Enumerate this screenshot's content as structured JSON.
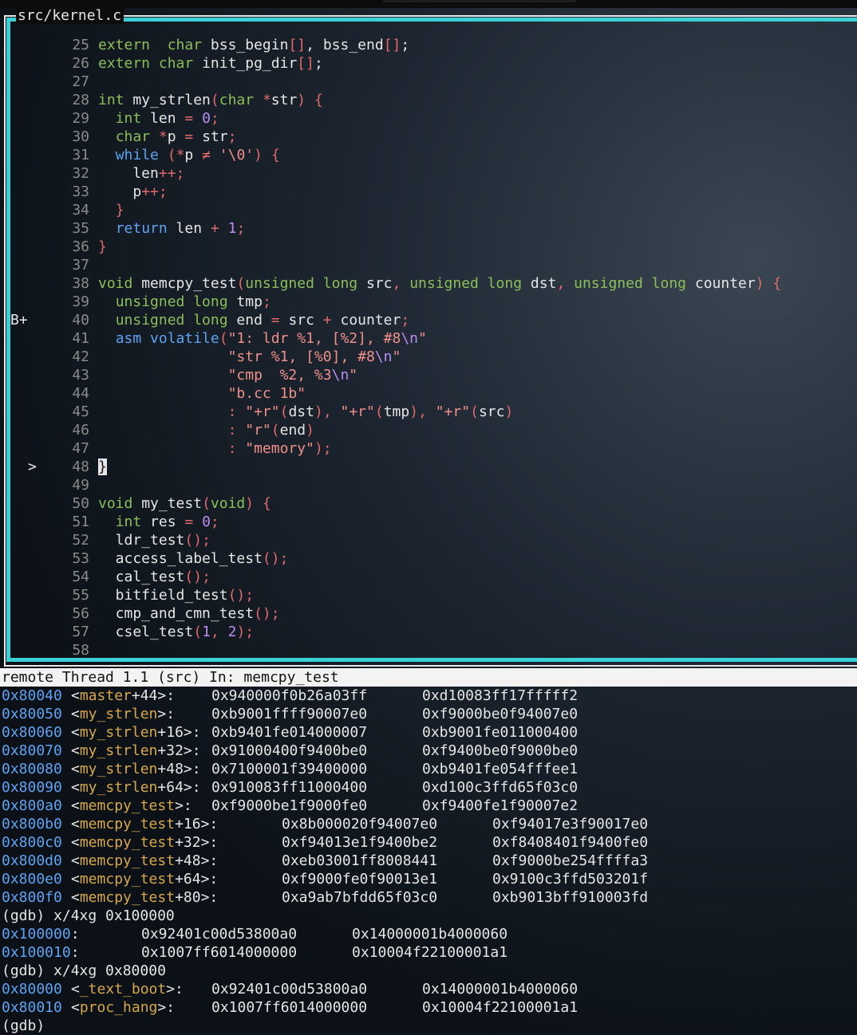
{
  "source_pane": {
    "title": "src/kernel.c",
    "lines": [
      {
        "n": "25",
        "m": "",
        "t": [
          [
            "ty",
            "extern"
          ],
          [
            "",
            "  "
          ],
          [
            "ty",
            "char"
          ],
          [
            "",
            " bss_begin"
          ],
          [
            "pu",
            "[]"
          ],
          [
            "",
            ", bss_end"
          ],
          [
            "pu",
            "[]"
          ],
          [
            "",
            ";"
          ]
        ]
      },
      {
        "n": "26",
        "m": "",
        "t": [
          [
            "ty",
            "extern"
          ],
          [
            "",
            " "
          ],
          [
            "ty",
            "char"
          ],
          [
            "",
            " init_pg_dir"
          ],
          [
            "pu",
            "[]"
          ],
          [
            "",
            ";"
          ]
        ]
      },
      {
        "n": "27",
        "m": "",
        "t": []
      },
      {
        "n": "28",
        "m": "",
        "t": [
          [
            "ty",
            "int"
          ],
          [
            "",
            " my_strlen"
          ],
          [
            "pu",
            "("
          ],
          [
            "ty",
            "char"
          ],
          [
            "",
            " "
          ],
          [
            "pu",
            "*"
          ],
          [
            "",
            "str"
          ],
          [
            "pu",
            ")"
          ],
          [
            "",
            " "
          ],
          [
            "pu",
            "{"
          ]
        ]
      },
      {
        "n": "29",
        "m": "",
        "t": [
          [
            "",
            "  "
          ],
          [
            "ty",
            "int"
          ],
          [
            "",
            " len "
          ],
          [
            "pu",
            "="
          ],
          [
            "",
            " "
          ],
          [
            "nm",
            "0"
          ],
          [
            "pu",
            ";"
          ]
        ]
      },
      {
        "n": "30",
        "m": "",
        "t": [
          [
            "",
            "  "
          ],
          [
            "ty",
            "char"
          ],
          [
            "",
            " "
          ],
          [
            "pu",
            "*"
          ],
          [
            "",
            "p "
          ],
          [
            "pu",
            "="
          ],
          [
            "",
            " str"
          ],
          [
            "pu",
            ";"
          ]
        ]
      },
      {
        "n": "31",
        "m": "",
        "t": [
          [
            "",
            "  "
          ],
          [
            "kw",
            "while"
          ],
          [
            "",
            " "
          ],
          [
            "pu",
            "("
          ],
          [
            "pu",
            "*"
          ],
          [
            "",
            "p "
          ],
          [
            "pu",
            "≠"
          ],
          [
            "",
            " "
          ],
          [
            "st",
            "'\\0'"
          ],
          [
            "pu",
            ")"
          ],
          [
            "",
            " "
          ],
          [
            "pu",
            "{"
          ]
        ]
      },
      {
        "n": "32",
        "m": "",
        "t": [
          [
            "",
            "    len"
          ],
          [
            "pu",
            "++"
          ],
          [
            "pu",
            ";"
          ]
        ]
      },
      {
        "n": "33",
        "m": "",
        "t": [
          [
            "",
            "    p"
          ],
          [
            "pu",
            "++"
          ],
          [
            "pu",
            ";"
          ]
        ]
      },
      {
        "n": "34",
        "m": "",
        "t": [
          [
            "",
            "  "
          ],
          [
            "pu",
            "}"
          ]
        ]
      },
      {
        "n": "35",
        "m": "",
        "t": [
          [
            "",
            "  "
          ],
          [
            "kw",
            "return"
          ],
          [
            "",
            " len "
          ],
          [
            "pu",
            "+"
          ],
          [
            "",
            " "
          ],
          [
            "nm",
            "1"
          ],
          [
            "pu",
            ";"
          ]
        ]
      },
      {
        "n": "36",
        "m": "",
        "t": [
          [
            "pu",
            "}"
          ]
        ]
      },
      {
        "n": "37",
        "m": "",
        "t": []
      },
      {
        "n": "38",
        "m": "",
        "t": [
          [
            "ty",
            "void"
          ],
          [
            "",
            " memcpy_test"
          ],
          [
            "pu",
            "("
          ],
          [
            "ty",
            "unsigned long"
          ],
          [
            "",
            " src"
          ],
          [
            "pu",
            ","
          ],
          [
            "",
            " "
          ],
          [
            "ty",
            "unsigned long"
          ],
          [
            "",
            " dst"
          ],
          [
            "pu",
            ","
          ],
          [
            "",
            " "
          ],
          [
            "ty",
            "unsigned long"
          ],
          [
            "",
            " counter"
          ],
          [
            "pu",
            ")"
          ],
          [
            "",
            " "
          ],
          [
            "pu",
            "{"
          ]
        ]
      },
      {
        "n": "39",
        "m": "",
        "t": [
          [
            "",
            "  "
          ],
          [
            "ty",
            "unsigned long"
          ],
          [
            "",
            " tmp"
          ],
          [
            "pu",
            ";"
          ]
        ]
      },
      {
        "n": "40",
        "m": "B+",
        "t": [
          [
            "",
            "  "
          ],
          [
            "ty",
            "unsigned long"
          ],
          [
            "",
            " end "
          ],
          [
            "pu",
            "="
          ],
          [
            "",
            " src "
          ],
          [
            "pu",
            "+"
          ],
          [
            "",
            " counter"
          ],
          [
            "pu",
            ";"
          ]
        ]
      },
      {
        "n": "41",
        "m": "",
        "t": [
          [
            "",
            "  "
          ],
          [
            "kw",
            "asm volatile"
          ],
          [
            "pu",
            "("
          ],
          [
            "st",
            "\"1: ldr %1, [%2], #8"
          ],
          [
            "nm",
            "\\n"
          ],
          [
            "st",
            "\""
          ]
        ]
      },
      {
        "n": "42",
        "m": "",
        "t": [
          [
            "",
            "               "
          ],
          [
            "st",
            "\"str %1, [%0], #8"
          ],
          [
            "nm",
            "\\n"
          ],
          [
            "st",
            "\""
          ]
        ]
      },
      {
        "n": "43",
        "m": "",
        "t": [
          [
            "",
            "               "
          ],
          [
            "st",
            "\"cmp  %2, %3"
          ],
          [
            "nm",
            "\\n"
          ],
          [
            "st",
            "\""
          ]
        ]
      },
      {
        "n": "44",
        "m": "",
        "t": [
          [
            "",
            "               "
          ],
          [
            "st",
            "\"b.cc 1b\""
          ]
        ]
      },
      {
        "n": "45",
        "m": "",
        "t": [
          [
            "",
            "               "
          ],
          [
            "pu",
            ":"
          ],
          [
            "",
            " "
          ],
          [
            "st",
            "\"+r\""
          ],
          [
            "pu",
            "("
          ],
          [
            "",
            "dst"
          ],
          [
            "pu",
            ")"
          ],
          [
            "pu",
            ","
          ],
          [
            "",
            " "
          ],
          [
            "st",
            "\"+r\""
          ],
          [
            "pu",
            "("
          ],
          [
            "",
            "tmp"
          ],
          [
            "pu",
            ")"
          ],
          [
            "pu",
            ","
          ],
          [
            "",
            " "
          ],
          [
            "st",
            "\"+r\""
          ],
          [
            "pu",
            "("
          ],
          [
            "",
            "src"
          ],
          [
            "pu",
            ")"
          ]
        ]
      },
      {
        "n": "46",
        "m": "",
        "t": [
          [
            "",
            "               "
          ],
          [
            "pu",
            ":"
          ],
          [
            "",
            " "
          ],
          [
            "st",
            "\"r\""
          ],
          [
            "pu",
            "("
          ],
          [
            "",
            "end"
          ],
          [
            "pu",
            ")"
          ]
        ]
      },
      {
        "n": "47",
        "m": "",
        "t": [
          [
            "",
            "               "
          ],
          [
            "pu",
            ":"
          ],
          [
            "",
            " "
          ],
          [
            "st",
            "\"memory\""
          ],
          [
            "pu",
            ")"
          ],
          [
            "pu",
            ";"
          ]
        ]
      },
      {
        "n": "48",
        "m": ">",
        "t": [
          [
            "cursor",
            "}"
          ]
        ]
      },
      {
        "n": "49",
        "m": "",
        "t": []
      },
      {
        "n": "50",
        "m": "",
        "t": [
          [
            "ty",
            "void"
          ],
          [
            "",
            " my_test"
          ],
          [
            "pu",
            "("
          ],
          [
            "ty",
            "void"
          ],
          [
            "pu",
            ")"
          ],
          [
            "",
            " "
          ],
          [
            "pu",
            "{"
          ]
        ]
      },
      {
        "n": "51",
        "m": "",
        "t": [
          [
            "",
            "  "
          ],
          [
            "ty",
            "int"
          ],
          [
            "",
            " res "
          ],
          [
            "pu",
            "="
          ],
          [
            "",
            " "
          ],
          [
            "nm",
            "0"
          ],
          [
            "pu",
            ";"
          ]
        ]
      },
      {
        "n": "52",
        "m": "",
        "t": [
          [
            "",
            "  ldr_test"
          ],
          [
            "pu",
            "()"
          ],
          [
            "pu",
            ";"
          ]
        ]
      },
      {
        "n": "53",
        "m": "",
        "t": [
          [
            "",
            "  access_label_test"
          ],
          [
            "pu",
            "()"
          ],
          [
            "pu",
            ";"
          ]
        ]
      },
      {
        "n": "54",
        "m": "",
        "t": [
          [
            "",
            "  cal_test"
          ],
          [
            "pu",
            "()"
          ],
          [
            "pu",
            ";"
          ]
        ]
      },
      {
        "n": "55",
        "m": "",
        "t": [
          [
            "",
            "  bitfield_test"
          ],
          [
            "pu",
            "()"
          ],
          [
            "pu",
            ";"
          ]
        ]
      },
      {
        "n": "56",
        "m": "",
        "t": [
          [
            "",
            "  cmp_and_cmn_test"
          ],
          [
            "pu",
            "()"
          ],
          [
            "pu",
            ";"
          ]
        ]
      },
      {
        "n": "57",
        "m": "",
        "t": [
          [
            "",
            "  csel_test"
          ],
          [
            "pu",
            "("
          ],
          [
            "nm",
            "1"
          ],
          [
            "pu",
            ","
          ],
          [
            "",
            " "
          ],
          [
            "nm",
            "2"
          ],
          [
            "pu",
            ")"
          ],
          [
            "pu",
            ";"
          ]
        ]
      },
      {
        "n": "58",
        "m": "",
        "t": []
      }
    ]
  },
  "status_bar": {
    "text": "remote Thread 1.1 (src) In: memcpy_test"
  },
  "gdb_output": [
    {
      "kind": "mem",
      "addr": "0x80040",
      "sym": "master",
      "off": "+44",
      "tail": ">:",
      "v1": "0x940000f0b26a03ff",
      "v2": "0xd10083ff17fffff2",
      "wide": false
    },
    {
      "kind": "mem",
      "addr": "0x80050",
      "sym": "my_strlen",
      "off": "",
      "tail": ">:",
      "v1": "0xb9001ffff90007e0",
      "v2": "0xf9000be0f94007e0",
      "wide": false
    },
    {
      "kind": "mem",
      "addr": "0x80060",
      "sym": "my_strlen",
      "off": "+16",
      "tail": ">:",
      "v1": "0xb9401fe014000007",
      "v2": "0xb9001fe011000400",
      "wide": false
    },
    {
      "kind": "mem",
      "addr": "0x80070",
      "sym": "my_strlen",
      "off": "+32",
      "tail": ">:",
      "v1": "0x91000400f9400be0",
      "v2": "0xf9400be0f9000be0",
      "wide": false
    },
    {
      "kind": "mem",
      "addr": "0x80080",
      "sym": "my_strlen",
      "off": "+48",
      "tail": ">:",
      "v1": "0x7100001f39400000",
      "v2": "0xb9401fe054fffee1",
      "wide": false
    },
    {
      "kind": "mem",
      "addr": "0x80090",
      "sym": "my_strlen",
      "off": "+64",
      "tail": ">:",
      "v1": "0x910083ff11000400",
      "v2": "0xd100c3ffd65f03c0",
      "wide": false
    },
    {
      "kind": "mem",
      "addr": "0x800a0",
      "sym": "memcpy_test",
      "off": "",
      "tail": ">:",
      "v1": "0xf9000be1f9000fe0",
      "v2": "0xf9400fe1f90007e2",
      "wide": false
    },
    {
      "kind": "mem",
      "addr": "0x800b0",
      "sym": "memcpy_test",
      "off": "+16",
      "tail": ">:",
      "v1": "0x8b000020f94007e0",
      "v2": "0xf94017e3f90017e0",
      "wide": true
    },
    {
      "kind": "mem",
      "addr": "0x800c0",
      "sym": "memcpy_test",
      "off": "+32",
      "tail": ">:",
      "v1": "0xf94013e1f9400be2",
      "v2": "0xf8408401f9400fe0",
      "wide": true
    },
    {
      "kind": "mem",
      "addr": "0x800d0",
      "sym": "memcpy_test",
      "off": "+48",
      "tail": ">:",
      "v1": "0xeb03001ff8008441",
      "v2": "0xf9000be254ffffa3",
      "wide": true
    },
    {
      "kind": "mem",
      "addr": "0x800e0",
      "sym": "memcpy_test",
      "off": "+64",
      "tail": ">:",
      "v1": "0xf9000fe0f90013e1",
      "v2": "0x9100c3ffd503201f",
      "wide": true
    },
    {
      "kind": "mem",
      "addr": "0x800f0",
      "sym": "memcpy_test",
      "off": "+80",
      "tail": ">:",
      "v1": "0xa9ab7bfdd65f03c0",
      "v2": "0xb9013bff910003fd",
      "wide": true
    },
    {
      "kind": "cmd",
      "text": "(gdb) x/4xg 0x100000"
    },
    {
      "kind": "raw",
      "addr": "0x100000",
      "tail": ":",
      "v1": "0x92401c00d53800a0",
      "v2": "0x14000001b4000060"
    },
    {
      "kind": "raw",
      "addr": "0x100010",
      "tail": ":",
      "v1": "0x1007ff6014000000",
      "v2": "0x10004f22100001a1"
    },
    {
      "kind": "cmd",
      "text": "(gdb) x/4xg 0x80000"
    },
    {
      "kind": "mem",
      "addr": "0x80000",
      "sym": "_text_boot",
      "off": "",
      "tail": ">:",
      "v1": "0x92401c00d53800a0",
      "v2": "0x14000001b4000060",
      "wide": false
    },
    {
      "kind": "mem",
      "addr": "0x80010",
      "sym": "proc_hang",
      "off": "",
      "tail": ">:",
      "v1": "0x1007ff6014000000",
      "v2": "0x10004f22100001a1",
      "wide": false
    },
    {
      "kind": "cmd",
      "text": "(gdb) "
    }
  ],
  "colors": {
    "frame_accent": "#3ad0d8",
    "keyword": "#5ea3f2",
    "type": "#8bbf5a",
    "punct": "#e06a6a",
    "number": "#b88cf0",
    "string": "#f0908a",
    "symbol": "#d6a84a"
  }
}
